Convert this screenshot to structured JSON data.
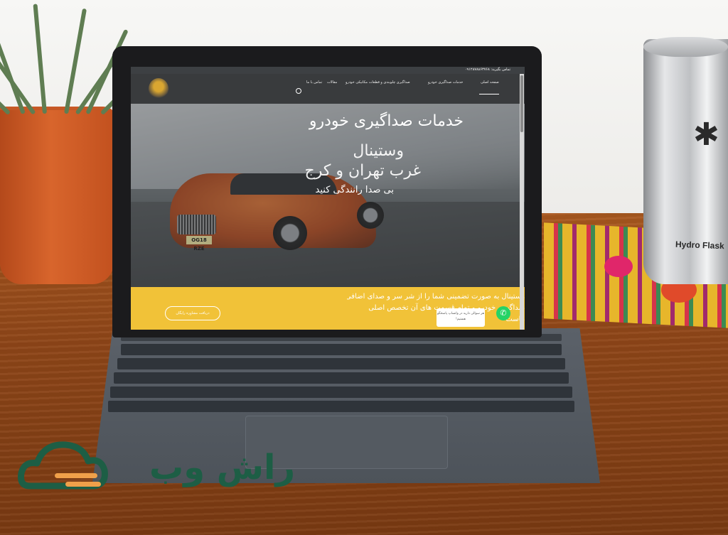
{
  "photo": {
    "cup_brand": "Hydro Flask",
    "watermark_brand": "راش وب",
    "colors": {
      "desk": "#8f4618",
      "pot": "#d8652c",
      "laptop": "#1b1b1d",
      "keyboard": "#4d535a",
      "watermark": "#1d5e45"
    }
  },
  "website": {
    "topbar": {
      "phone": "تماس بگیرید: ۰۹۱۲۸۷۸۸۶۳۷۶۸"
    },
    "nav": {
      "items": [
        {
          "label": "صفحه اصلی"
        },
        {
          "label": "خدمات صداگیری خودرو"
        },
        {
          "label": "صداگیری چلوبندی و قطعات مکانیکی خودرو"
        },
        {
          "label": "مقالات"
        },
        {
          "label": "تماس با ما"
        }
      ],
      "search_icon": "search-icon"
    },
    "hero": {
      "title": "خدمات صداگیری خودرو",
      "line1": "وستینال",
      "line2": "غرب تهران و کرج",
      "line3": "بی صدا رانندگی کنید",
      "plate": "OG18 RZE"
    },
    "band": {
      "text_line1": "وستینال به صورت تضمینی شما را از شر سر و صدای اضافی داخل خودرو",
      "text_line2": "صداگیری خودرو و تمام قسمت های آن تخصص اصلی",
      "text_line3": "ماست",
      "cta_label": "دریافت مشاوره رایگان",
      "colors": {
        "band": "#f1c238"
      }
    },
    "whatsapp": {
      "bubble_line1": "هر سوالی دارید در واتساپ پاسخگو",
      "bubble_line2": "هستیم!",
      "icon": "whatsapp-icon"
    }
  }
}
